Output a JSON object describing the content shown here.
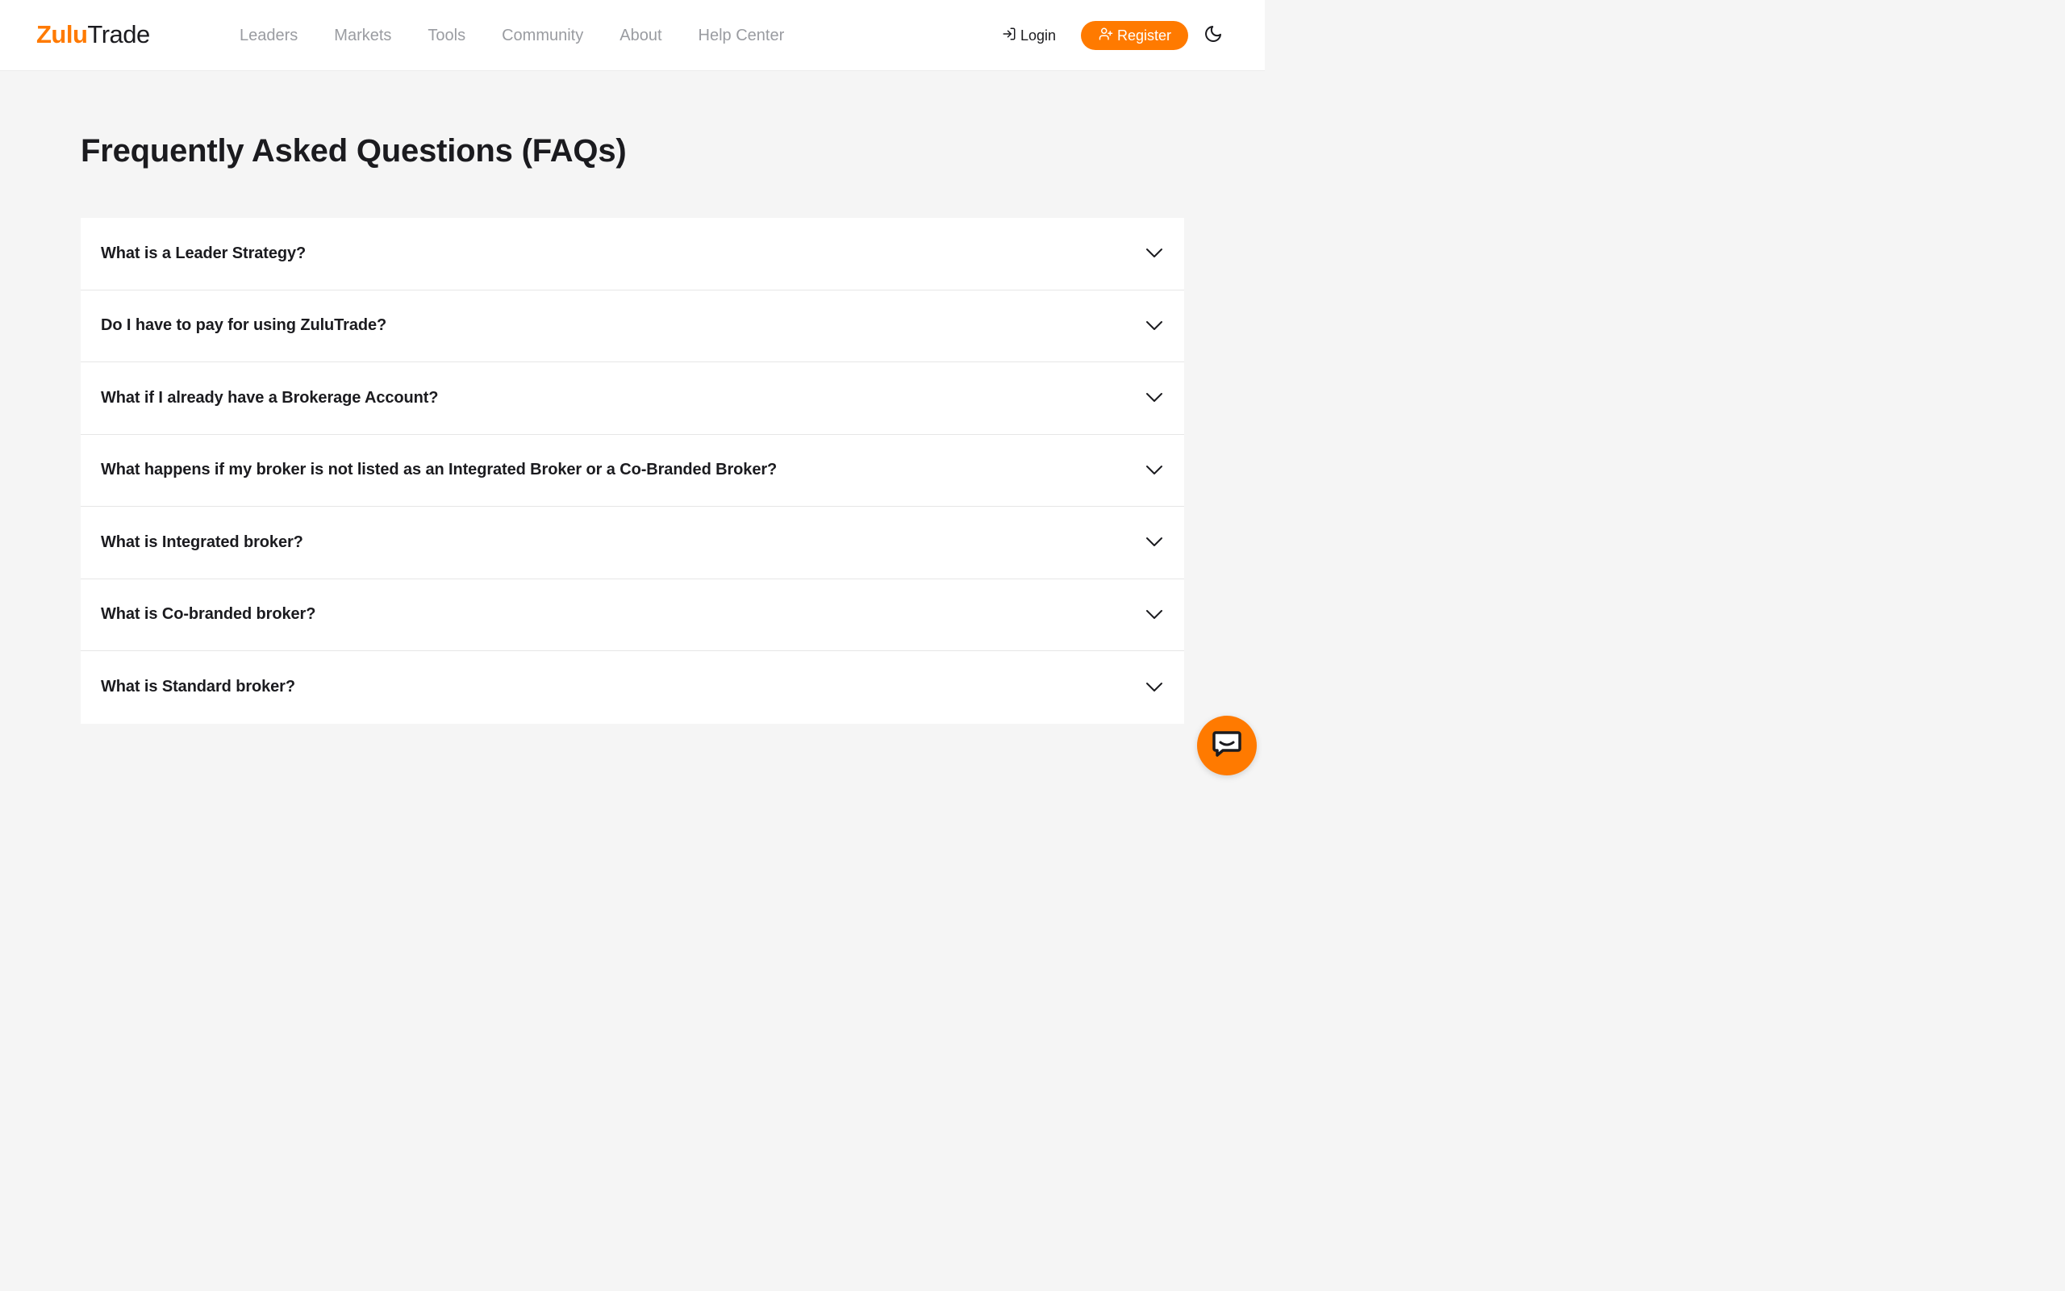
{
  "header": {
    "logo_part1": "Zulu",
    "logo_part2": "Trade",
    "nav": [
      "Leaders",
      "Markets",
      "Tools",
      "Community",
      "About",
      "Help Center"
    ],
    "login_label": "Login",
    "register_label": "Register",
    "theme_icon": "moon-icon"
  },
  "main": {
    "title": "Frequently Asked Questions (FAQs)",
    "faqs": [
      "What is a Leader Strategy?",
      "Do I have to pay for using ZuluTrade?",
      "What if I already have a Brokerage Account?",
      "What happens if my broker is not listed as an Integrated Broker or a Co-Branded Broker?",
      "What is Integrated broker?",
      "What is Co-branded broker?",
      "What is Standard broker?"
    ]
  },
  "chat": {
    "icon": "chat-icon"
  },
  "colors": {
    "brand": "#ff7a00",
    "text": "#1b1b1f",
    "nav_text": "#9a9ca1",
    "background": "#f5f5f5"
  }
}
